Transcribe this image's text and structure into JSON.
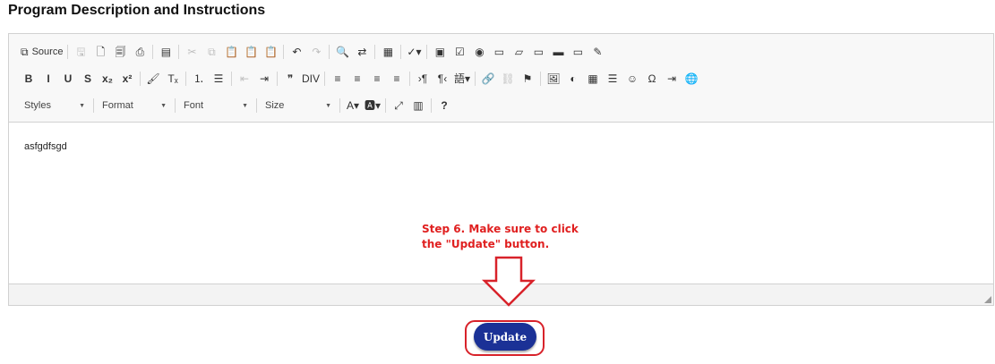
{
  "page": {
    "title": "Program Description and Instructions"
  },
  "toolbar": {
    "row1": [
      {
        "name": "source-button",
        "glyph": "⧉",
        "label": "Source"
      },
      {
        "sep": true
      },
      {
        "name": "save-button",
        "glyph": "🖫",
        "dim": true
      },
      {
        "name": "new-page-button",
        "glyph": "🗋"
      },
      {
        "name": "preview-button",
        "glyph": "🗐"
      },
      {
        "name": "print-button",
        "glyph": "⎙"
      },
      {
        "sep": true
      },
      {
        "name": "templates-button",
        "glyph": "▤"
      },
      {
        "sep": true
      },
      {
        "name": "cut-button",
        "glyph": "✂",
        "dim": true
      },
      {
        "name": "copy-button",
        "glyph": "⧉",
        "dim": true
      },
      {
        "name": "paste-button",
        "glyph": "📋"
      },
      {
        "name": "paste-text-button",
        "glyph": "📋"
      },
      {
        "name": "paste-word-button",
        "glyph": "📋"
      },
      {
        "sep": true
      },
      {
        "name": "undo-button",
        "glyph": "↶"
      },
      {
        "name": "redo-button",
        "glyph": "↷",
        "dim": true
      },
      {
        "sep": true
      },
      {
        "name": "find-button",
        "glyph": "🔍"
      },
      {
        "name": "replace-button",
        "glyph": "⇄"
      },
      {
        "sep": true
      },
      {
        "name": "select-all-button",
        "glyph": "▦"
      },
      {
        "sep": true
      },
      {
        "name": "spellcheck-button",
        "glyph": "✓▾"
      },
      {
        "sep": true
      },
      {
        "name": "form-button",
        "glyph": "▣"
      },
      {
        "name": "checkbox-button",
        "glyph": "☑"
      },
      {
        "name": "radio-button",
        "glyph": "◉"
      },
      {
        "name": "textfield-button",
        "glyph": "▭"
      },
      {
        "name": "textarea-button",
        "glyph": "▱"
      },
      {
        "name": "select-button",
        "glyph": "▭"
      },
      {
        "name": "button-button",
        "glyph": "▬"
      },
      {
        "name": "imagebutton-button",
        "glyph": "▭"
      },
      {
        "name": "hiddenfield-button",
        "glyph": "✎"
      }
    ],
    "row2": [
      {
        "name": "bold-button",
        "glyph": "B",
        "bold": true
      },
      {
        "name": "italic-button",
        "glyph": "I",
        "bold": true
      },
      {
        "name": "underline-button",
        "glyph": "U",
        "bold": true
      },
      {
        "name": "strike-button",
        "glyph": "S",
        "bold": true
      },
      {
        "name": "subscript-button",
        "glyph": "x₂",
        "bold": true
      },
      {
        "name": "superscript-button",
        "glyph": "x²",
        "bold": true
      },
      {
        "sep": true
      },
      {
        "name": "copy-format-button",
        "glyph": "🖌"
      },
      {
        "name": "remove-format-button",
        "glyph": "Tₓ"
      },
      {
        "sep": true
      },
      {
        "name": "numbered-list-button",
        "glyph": "⒈"
      },
      {
        "name": "bulleted-list-button",
        "glyph": "☰"
      },
      {
        "sep": true
      },
      {
        "name": "outdent-button",
        "glyph": "⇤",
        "dim": true
      },
      {
        "name": "indent-button",
        "glyph": "⇥"
      },
      {
        "sep": true
      },
      {
        "name": "blockquote-button",
        "glyph": "❞"
      },
      {
        "name": "div-button",
        "glyph": "DIV"
      },
      {
        "sep": true
      },
      {
        "name": "align-left-button",
        "glyph": "≡"
      },
      {
        "name": "align-center-button",
        "glyph": "≡"
      },
      {
        "name": "align-right-button",
        "glyph": "≡"
      },
      {
        "name": "justify-button",
        "glyph": "≡"
      },
      {
        "sep": true
      },
      {
        "name": "ltr-button",
        "glyph": "›¶"
      },
      {
        "name": "rtl-button",
        "glyph": "¶‹"
      },
      {
        "name": "language-button",
        "glyph": "語▾"
      },
      {
        "sep": true
      },
      {
        "name": "link-button",
        "glyph": "🔗"
      },
      {
        "name": "unlink-button",
        "glyph": "⛓",
        "dim": true
      },
      {
        "name": "anchor-button",
        "glyph": "⚑"
      },
      {
        "sep": true
      },
      {
        "name": "image-button",
        "glyph": "🖼"
      },
      {
        "name": "flash-button",
        "glyph": "◐"
      },
      {
        "name": "table-button",
        "glyph": "▦"
      },
      {
        "name": "hline-button",
        "glyph": "☰"
      },
      {
        "name": "smiley-button",
        "glyph": "☺"
      },
      {
        "name": "special-char-button",
        "glyph": "Ω"
      },
      {
        "name": "page-break-button",
        "glyph": "⇥"
      },
      {
        "name": "iframe-button",
        "glyph": "🌐"
      }
    ],
    "row3": {
      "combos": [
        {
          "name": "styles-combo",
          "label": "Styles",
          "width": 80
        },
        {
          "name": "format-combo",
          "label": "Format",
          "width": 84
        },
        {
          "name": "font-combo",
          "label": "Font",
          "width": 84
        },
        {
          "name": "size-combo",
          "label": "Size",
          "width": 86
        }
      ],
      "buttons": [
        {
          "name": "text-color-button",
          "glyph": "A▾"
        },
        {
          "name": "bg-color-button",
          "glyph": "🅰▾"
        },
        {
          "sep": true
        },
        {
          "name": "maximize-button",
          "glyph": "⤢"
        },
        {
          "name": "show-blocks-button",
          "glyph": "▥"
        },
        {
          "sep": true
        },
        {
          "name": "about-button",
          "glyph": "?",
          "bold": true
        }
      ]
    }
  },
  "editor": {
    "content": "asfgdfsgd"
  },
  "annotation": {
    "line1": "Step 6. Make sure to click",
    "line2": "the \"Update\" button."
  },
  "actions": {
    "update_label": "Update"
  },
  "colors": {
    "annotation_red": "#e02020",
    "update_bg": "#1b3196",
    "ring_red": "#d8222a"
  }
}
